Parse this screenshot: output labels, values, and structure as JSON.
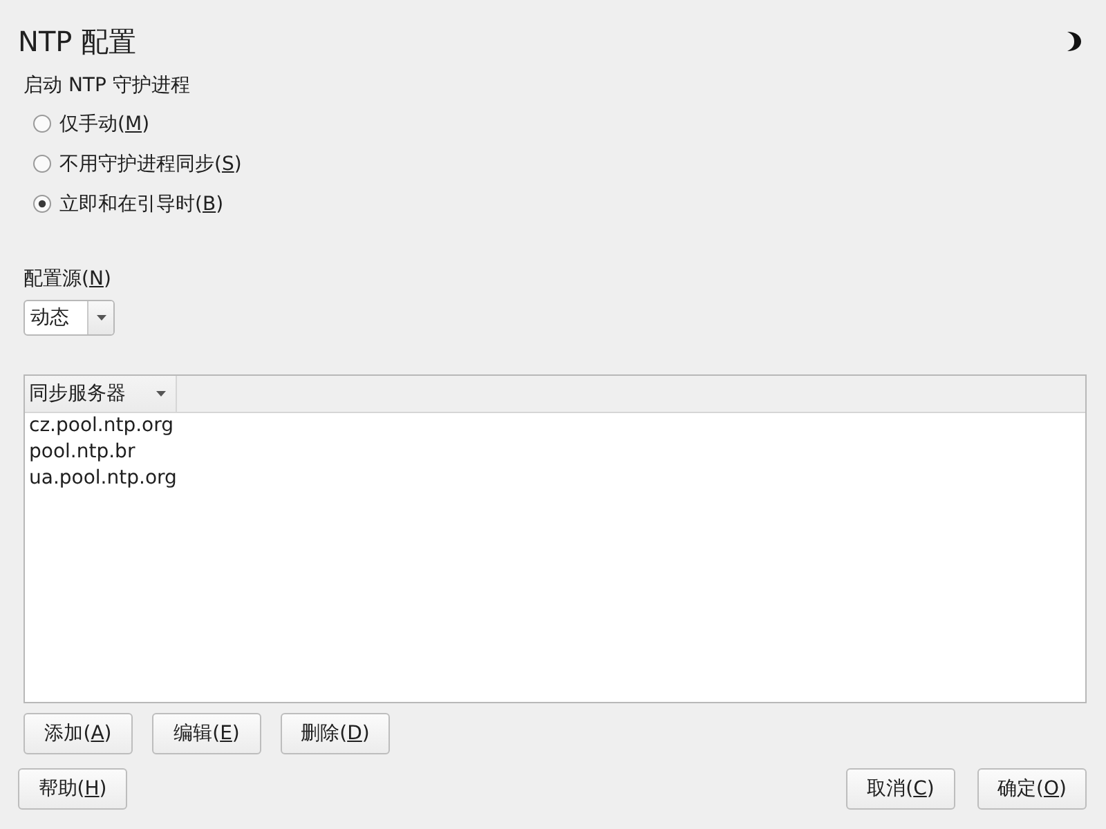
{
  "window": {
    "title": "NTP 配置"
  },
  "daemon": {
    "label": "启动 NTP 守护进程",
    "options": [
      {
        "label": "仅手动(M)",
        "mnemonic": true,
        "selected": false
      },
      {
        "label": "不用守护进程同步(S)",
        "mnemonic": true,
        "selected": false
      },
      {
        "label": "立即和在引导时(B)",
        "mnemonic": true,
        "selected": true
      }
    ]
  },
  "config_source": {
    "label": "配置源(N)",
    "mnemonic": true,
    "value": "动态"
  },
  "servers": {
    "columns": [
      {
        "label": "同步服务器",
        "sorted": true
      }
    ],
    "rows": [
      "cz.pool.ntp.org",
      "pool.ntp.br",
      "ua.pool.ntp.org"
    ]
  },
  "list_buttons": [
    {
      "label": "添加(A)",
      "mnemonic": true
    },
    {
      "label": "编辑(E)",
      "mnemonic": true
    },
    {
      "label": "删除(D)",
      "mnemonic": true
    }
  ],
  "footer": {
    "left": [
      {
        "label": "帮助(H)",
        "mnemonic": true
      }
    ],
    "right": [
      {
        "label": "取消(C)",
        "mnemonic": true
      },
      {
        "label": "确定(O)",
        "mnemonic": true
      }
    ]
  }
}
